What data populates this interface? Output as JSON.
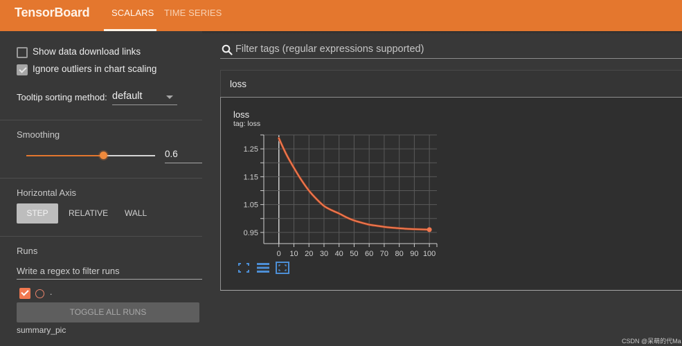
{
  "header": {
    "brand": "TensorBoard",
    "tabs": [
      {
        "label": "SCALARS",
        "active": true
      },
      {
        "label": "TIME SERIES",
        "active": false
      }
    ],
    "accent_color": "#e4772e"
  },
  "sidebar": {
    "show_download_links": {
      "label": "Show data download links",
      "checked": false
    },
    "ignore_outliers": {
      "label": "Ignore outliers in chart scaling",
      "checked": true
    },
    "tooltip_sorting": {
      "label": "Tooltip sorting method:",
      "value": "default"
    },
    "smoothing": {
      "title": "Smoothing",
      "value": "0.6",
      "slider_fraction": 0.6
    },
    "horizontal_axis": {
      "title": "Horizontal Axis",
      "options": [
        "STEP",
        "RELATIVE",
        "WALL"
      ],
      "selected": "STEP"
    },
    "runs": {
      "title": "Runs",
      "filter_placeholder": "Write a regex to filter runs",
      "items": [
        {
          "name": ".",
          "checked": true,
          "color": "#f07850"
        }
      ],
      "toggle_all_label": "TOGGLE ALL RUNS",
      "group_label": "summary_pic"
    }
  },
  "main": {
    "filter_placeholder": "Filter tags (regular expressions supported)",
    "category": {
      "title": "loss"
    },
    "card": {
      "title": "loss",
      "tag": "tag: loss",
      "buttons": [
        "fullscreen-icon",
        "toggle-log-scale-icon",
        "fit-domain-icon"
      ]
    }
  },
  "watermark": "CSDN @呆萌的代Ma",
  "chart_data": {
    "type": "line",
    "title": "loss",
    "subtitle": "tag: loss",
    "xlabel": "",
    "ylabel": "",
    "xlim": [
      -10,
      105
    ],
    "ylim": [
      0.91,
      1.3
    ],
    "x_ticks": [
      0,
      10,
      20,
      30,
      40,
      50,
      60,
      70,
      80,
      90,
      100
    ],
    "y_ticks": [
      0.95,
      1.05,
      1.15,
      1.25
    ],
    "grid": true,
    "legend": "none",
    "series": [
      {
        "name": ".",
        "color": "#f07850",
        "x": [
          0,
          5,
          10,
          15,
          20,
          25,
          30,
          35,
          40,
          45,
          50,
          55,
          60,
          65,
          70,
          75,
          80,
          85,
          90,
          95,
          100
        ],
        "y": [
          1.288,
          1.23,
          1.182,
          1.138,
          1.1,
          1.07,
          1.045,
          1.03,
          1.018,
          1.004,
          0.993,
          0.985,
          0.978,
          0.974,
          0.97,
          0.967,
          0.965,
          0.963,
          0.962,
          0.961,
          0.96
        ]
      }
    ]
  }
}
